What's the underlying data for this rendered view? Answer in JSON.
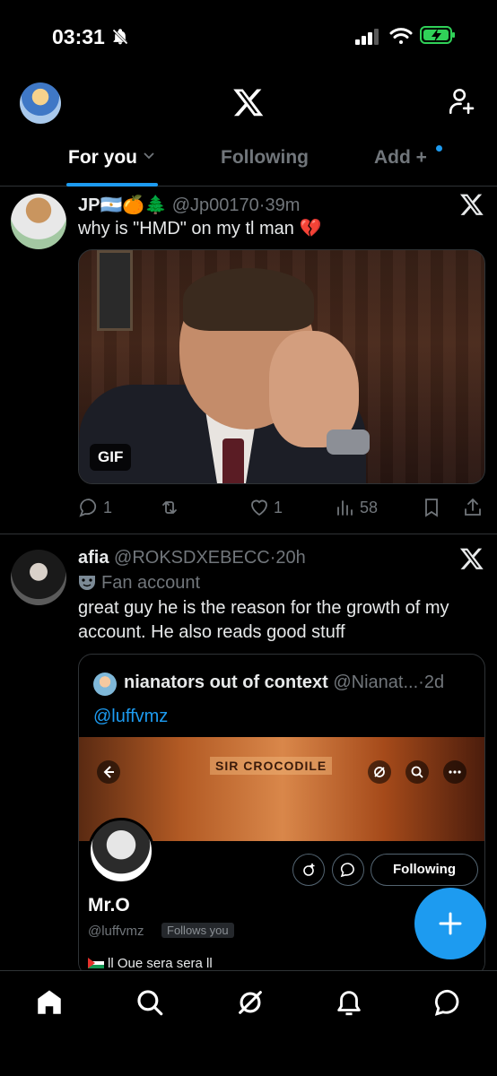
{
  "status_bar": {
    "time": "03:31"
  },
  "header": {
    "logo": "X"
  },
  "tabs": [
    {
      "label": "For you",
      "active": true
    },
    {
      "label": "Following",
      "active": false
    },
    {
      "label": "Add",
      "active": false
    }
  ],
  "tweets": [
    {
      "name": "JP🇦🇷🍊🌲",
      "handle": "@Jp00170",
      "time": "39m",
      "text": "why is \"HMD\" on my tl man 💔",
      "media_badge": "GIF",
      "replies": "1",
      "retweets": "",
      "likes": "1",
      "views": "58"
    },
    {
      "name": "afia",
      "handle": "@ROKSDXEBECC",
      "time": "20h",
      "label": "Fan account",
      "text": "great guy he is the reason for the growth of my account. He also reads good stuff",
      "quote": {
        "name": "nianators out of context",
        "handle": "@Nianat...",
        "time": "2d",
        "text": "@luffvmz",
        "profile": {
          "banner_text": "SIR CROCODILE",
          "name": "Mr.O",
          "handle": "@luffvmz",
          "follows_you": "Follows you",
          "follow_button": "Following",
          "bio": "ll Oue sera sera ll"
        }
      }
    }
  ],
  "colors": {
    "accent": "#1d9bf0",
    "background": "#000000",
    "secondary_text": "#71767b",
    "divider": "#2f3336"
  }
}
